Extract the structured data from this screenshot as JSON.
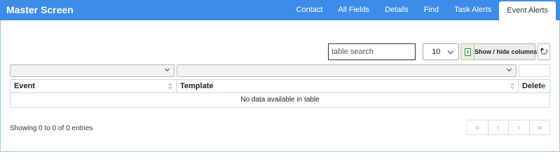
{
  "app": {
    "title": "Master Screen"
  },
  "nav": {
    "tabs": [
      {
        "label": "Contact"
      },
      {
        "label": "All Fields"
      },
      {
        "label": "Details"
      },
      {
        "label": "Find"
      },
      {
        "label": "Task Alerts"
      },
      {
        "label": "Event Alerts",
        "active": true
      }
    ]
  },
  "toolbar": {
    "search_placeholder": "table search",
    "page_size": "10",
    "excel_icon": "excel-icon",
    "columns_label": "Show / hide columns",
    "reset_icon": "refresh-icon"
  },
  "table": {
    "columns": [
      {
        "label": "Event"
      },
      {
        "label": "Template"
      },
      {
        "label": "Delete"
      }
    ],
    "empty_message": "No data available in table"
  },
  "footer": {
    "info": "Showing 0 to 0 of 0 entries",
    "pager": {
      "first": "«",
      "prev": "‹",
      "next": "›",
      "last": "»"
    }
  },
  "colors": {
    "topbar": "#3d8cea",
    "border": "#c8d8ee"
  }
}
